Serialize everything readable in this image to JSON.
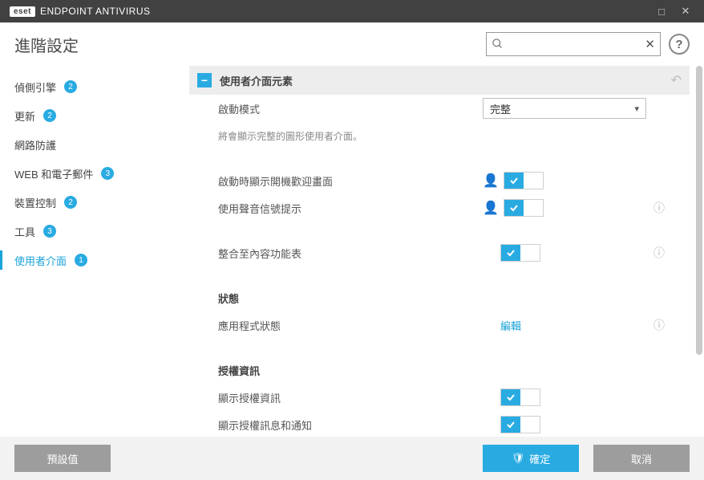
{
  "titlebar": {
    "brand": "eset",
    "product": "ENDPOINT ANTIVIRUS"
  },
  "header": {
    "page_title": "進階設定",
    "search_placeholder": ""
  },
  "sidebar": {
    "items": [
      {
        "label": "偵側引擎",
        "badge": "2"
      },
      {
        "label": "更新",
        "badge": "2"
      },
      {
        "label": "網路防護",
        "badge": ""
      },
      {
        "label": "WEB 和電子郵件",
        "badge": "3"
      },
      {
        "label": "裝置控制",
        "badge": "2"
      },
      {
        "label": "工具",
        "badge": "3"
      },
      {
        "label": "使用者介面",
        "badge": "1"
      }
    ]
  },
  "section": {
    "title": "使用者介面元素",
    "startup_mode_label": "啟動模式",
    "startup_mode_value": "完整",
    "startup_mode_desc": "將會顯示完整的圖形使用者介面。",
    "splash_label": "啟動時顯示開機歡迎畫面",
    "sound_label": "使用聲音信號提示",
    "context_label": "整合至內容功能表",
    "status_heading": "狀態",
    "app_status_label": "應用程式狀態",
    "app_status_link": "編輯",
    "license_heading": "授權資訊",
    "show_license_label": "顯示授權資訊",
    "show_license_msg_label": "顯示授權訊息和通知"
  },
  "footer": {
    "defaults": "預設值",
    "ok": "確定",
    "cancel": "取消"
  }
}
